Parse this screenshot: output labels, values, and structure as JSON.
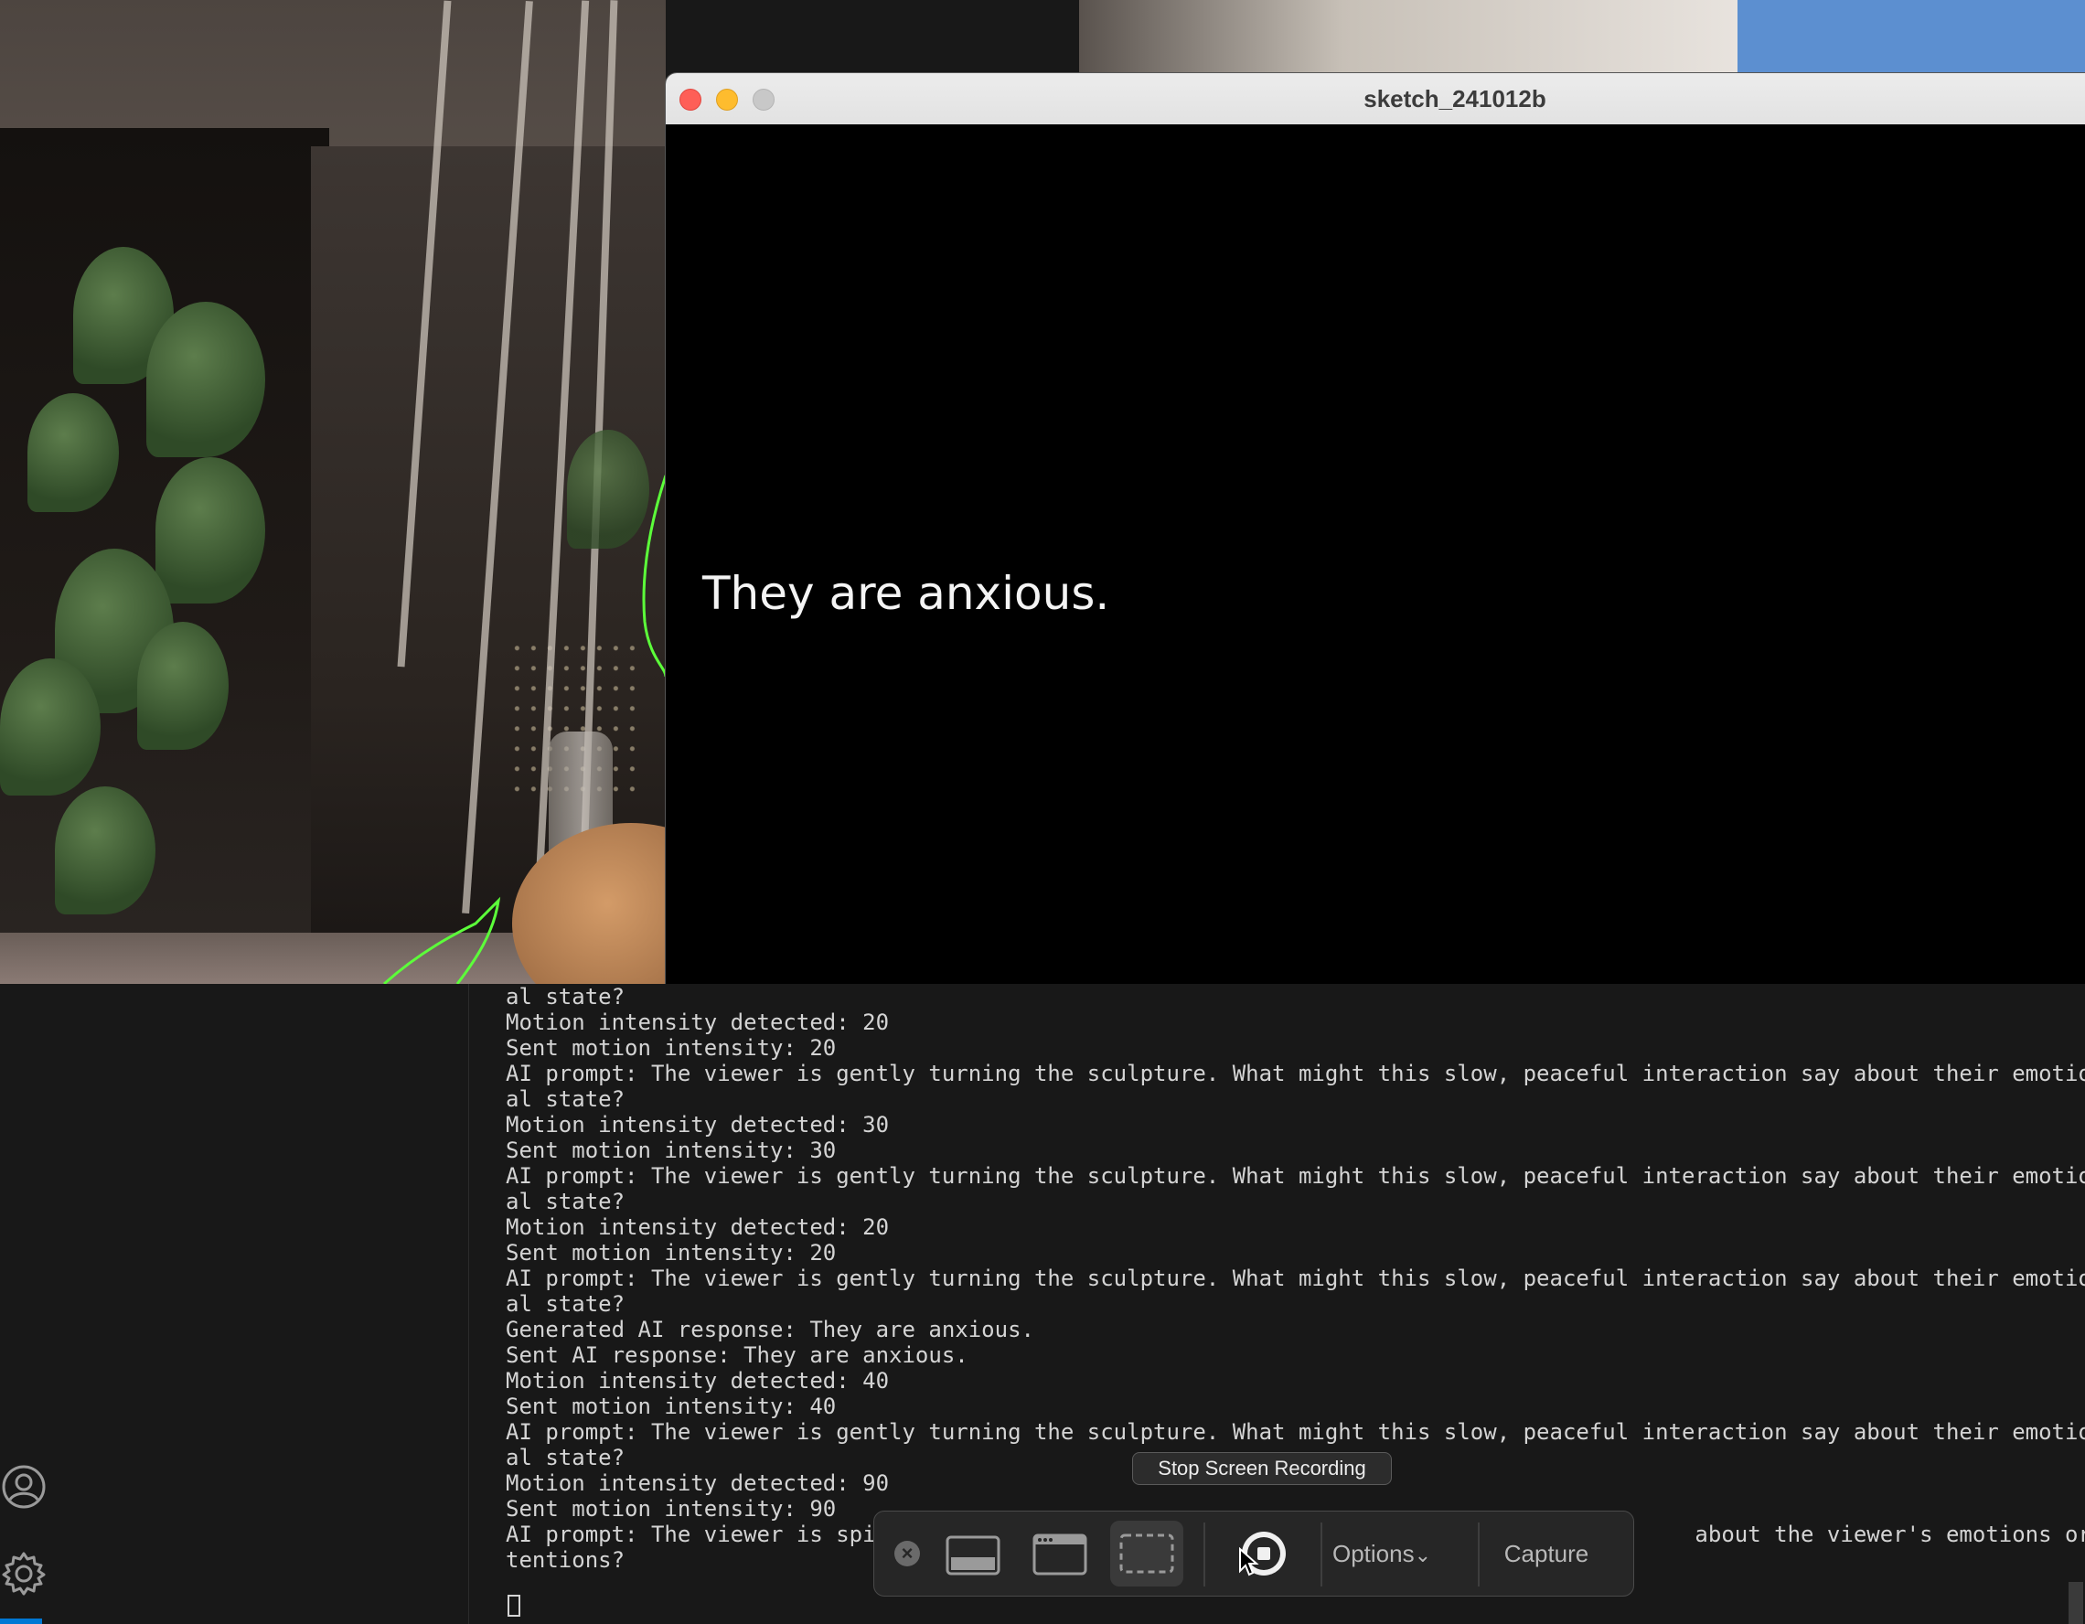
{
  "sketch_window": {
    "title": "sketch_241012b",
    "canvas_text": "They are anxious."
  },
  "terminal": {
    "lines": [
      "al state?",
      "Motion intensity detected: 20",
      "Sent motion intensity: 20",
      "AI prompt: The viewer is gently turning the sculpture. What might this slow, peaceful interaction say about their emotion",
      "al state?",
      "Motion intensity detected: 30",
      "Sent motion intensity: 30",
      "AI prompt: The viewer is gently turning the sculpture. What might this slow, peaceful interaction say about their emotion",
      "al state?",
      "Motion intensity detected: 20",
      "Sent motion intensity: 20",
      "AI prompt: The viewer is gently turning the sculpture. What might this slow, peaceful interaction say about their emotion",
      "al state?",
      "Generated AI response: They are anxious.",
      "Sent AI response: They are anxious.",
      "Motion intensity detected: 40",
      "Sent motion intensity: 40",
      "AI prompt: The viewer is gently turning the sculpture. What might this slow, peaceful interaction say about their emotion",
      "al state?",
      "Motion intensity detected: 90",
      "Sent motion intensity: 90",
      "AI prompt: The viewer is spir                                                             about the viewer's emotions or in",
      "tentions?"
    ]
  },
  "capture_toolbar": {
    "tooltip": "Stop Screen Recording",
    "close_glyph": "×",
    "options_label": "Options",
    "options_chevron": "⌄",
    "capture_label": "Capture"
  },
  "icons": {
    "account": "account-icon",
    "settings": "gear-icon",
    "stop_recording": "stop-recording-icon",
    "capture_entire_screen": "capture-entire-screen-icon",
    "capture_window": "capture-window-icon",
    "capture_selection": "capture-selection-icon"
  },
  "colors": {
    "close": "#fe5f57",
    "minimize": "#febc2e",
    "maximize_disabled": "#c8c8c8",
    "terminal_bg": "#181818",
    "terminal_text": "#d4d4d4",
    "outline_green": "#5cff3a"
  }
}
